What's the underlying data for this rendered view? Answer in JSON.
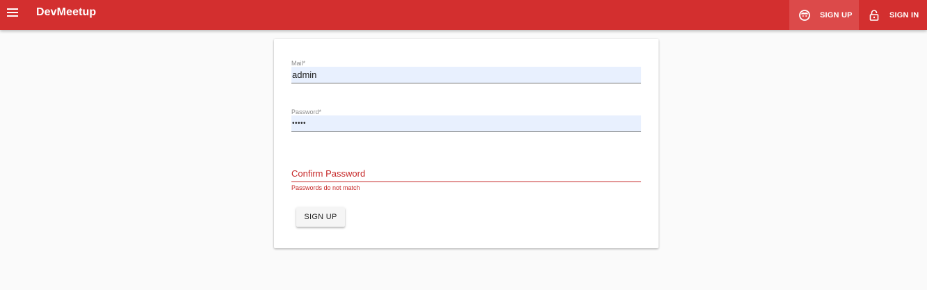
{
  "app": {
    "title": "DevMeetup"
  },
  "toolbar": {
    "menu_icon": "menu-icon",
    "background_color": "#d32f2f",
    "items": [
      {
        "label": "SIGN UP",
        "icon": "face-icon",
        "active": true
      },
      {
        "label": "SIGN IN",
        "icon": "lock-open-icon",
        "active": false
      }
    ]
  },
  "form": {
    "mail": {
      "label": "Mail*",
      "value": "admin"
    },
    "password": {
      "label": "Password*",
      "value": "•••••"
    },
    "confirm_password": {
      "placeholder": "Confirm Password",
      "value": "",
      "error": "Passwords do not match"
    },
    "submit_label": "SIGN UP",
    "error_color": "#c62828",
    "autofill_color": "#e8f0fe"
  }
}
